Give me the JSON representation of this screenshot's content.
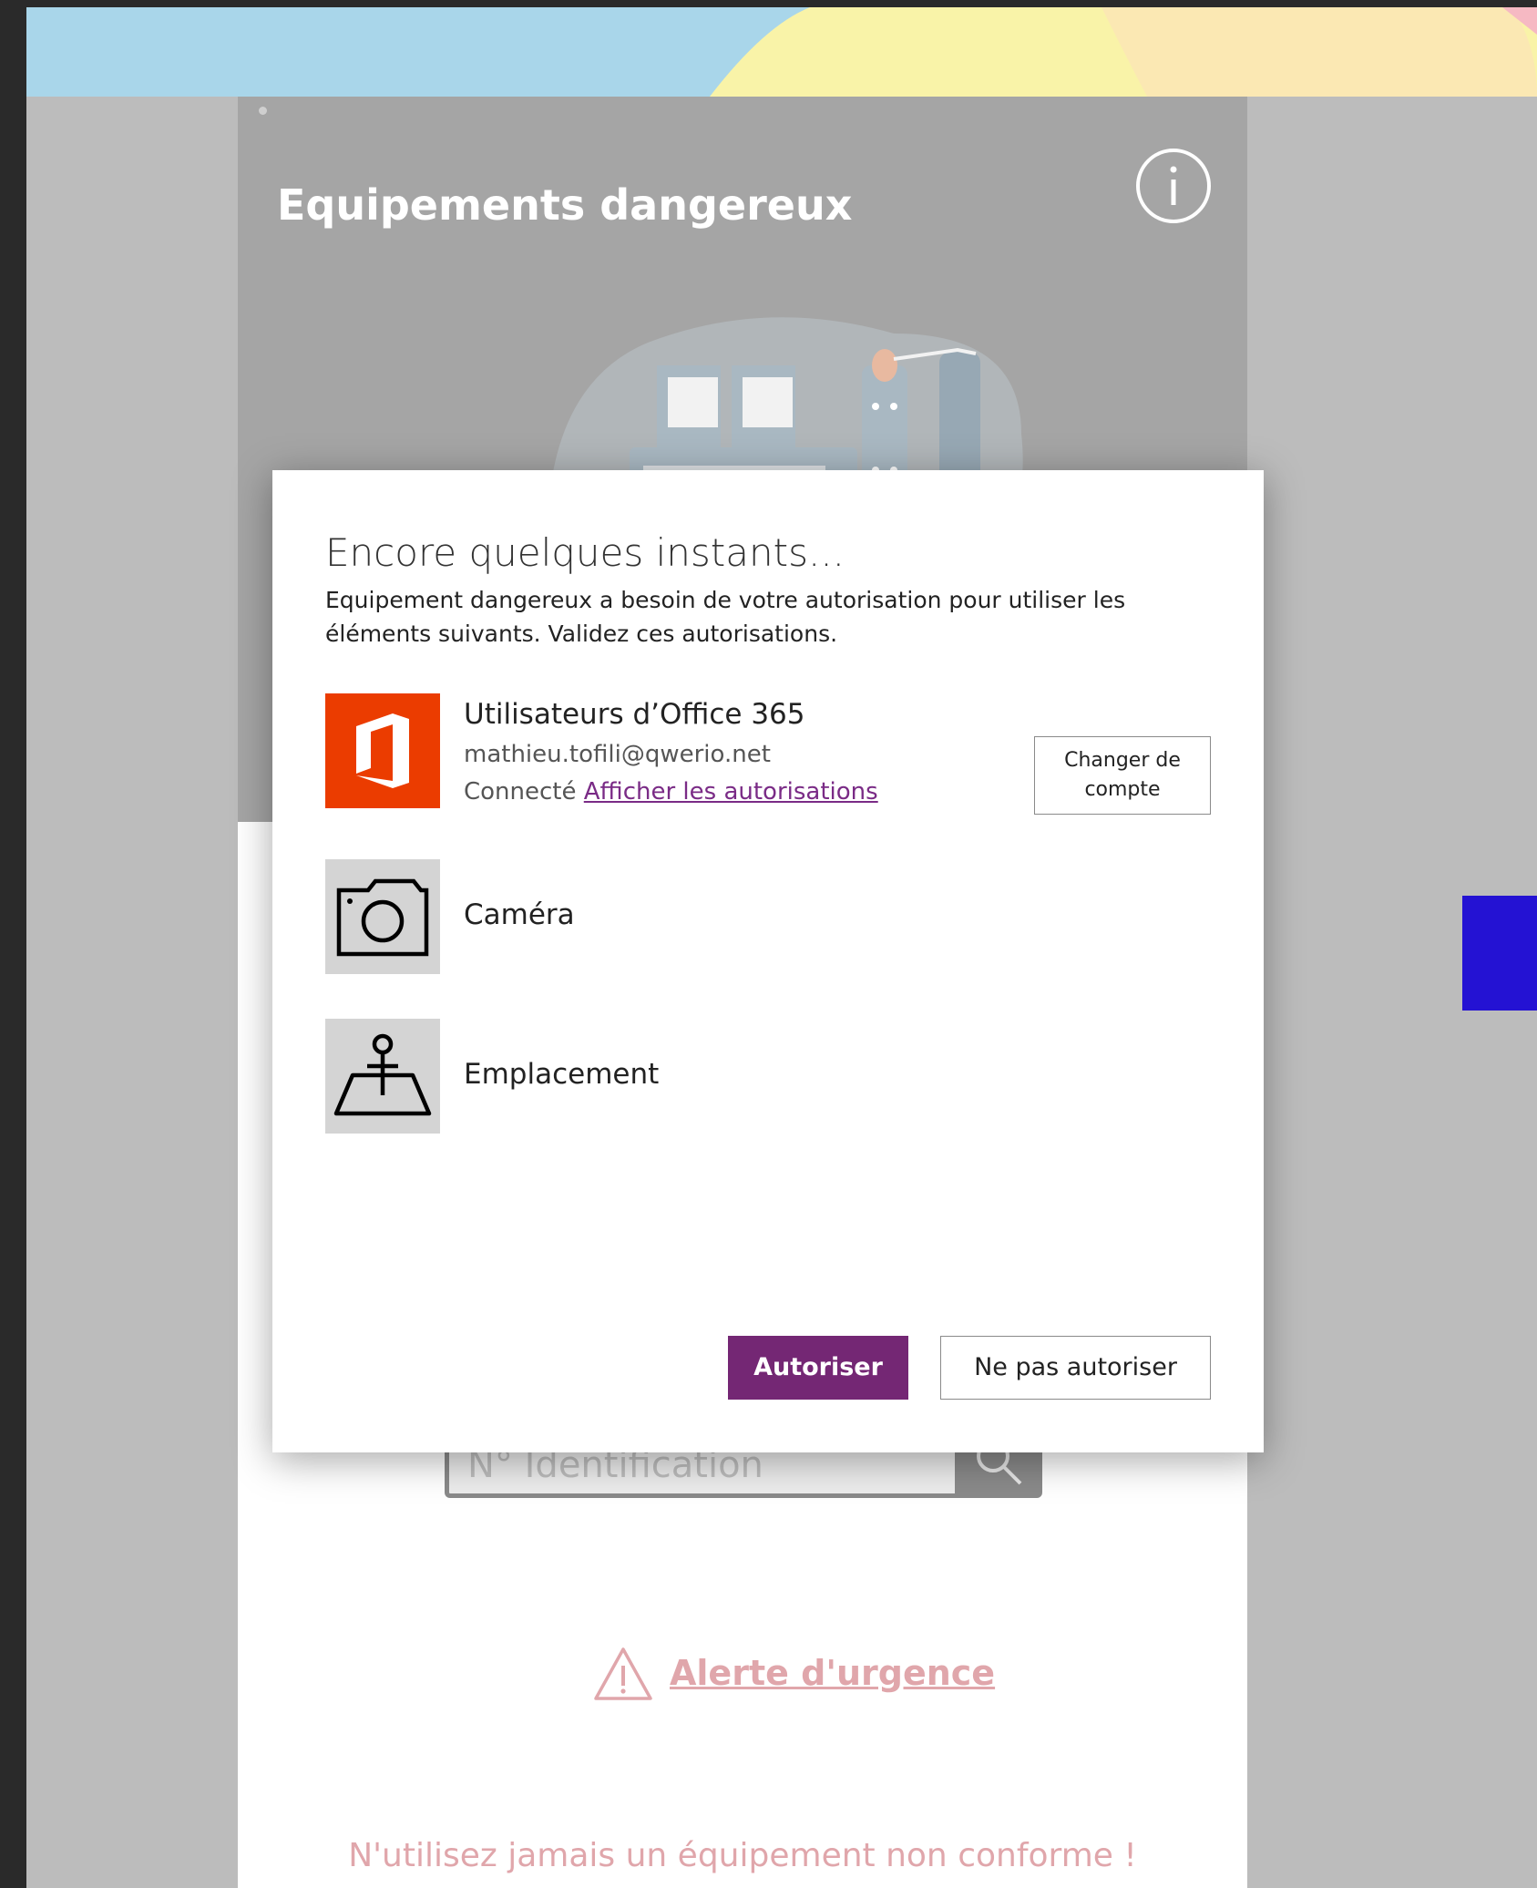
{
  "app": {
    "title": "Equipements dangereux",
    "id_placeholder": "N° Identification",
    "alert_label": "Alerte d'urgence",
    "footer_warning": "N'utilisez jamais un équipement non conforme !"
  },
  "dialog": {
    "title": "Encore quelques instants...",
    "description": "Equipement dangereux a besoin de votre autorisation pour utiliser les éléments suivants. Validez ces autorisations.",
    "permissions": [
      {
        "name": "Utilisateurs d’Office 365",
        "account": "mathieu.tofili@qwerio.net",
        "status": "Connecté",
        "link": "Afficher les autorisations",
        "icon": "office-365-icon"
      },
      {
        "name": "Caméra",
        "icon": "camera-icon"
      },
      {
        "name": "Emplacement",
        "icon": "location-icon"
      }
    ],
    "change_account": "Changer de compte",
    "allow_label": "Autoriser",
    "deny_label": "Ne pas autoriser"
  },
  "colors": {
    "office_orange": "#eb3c00",
    "primary_purple": "#742774",
    "alert_pink": "#e0a6ab",
    "side_accent": "#2412d3"
  }
}
